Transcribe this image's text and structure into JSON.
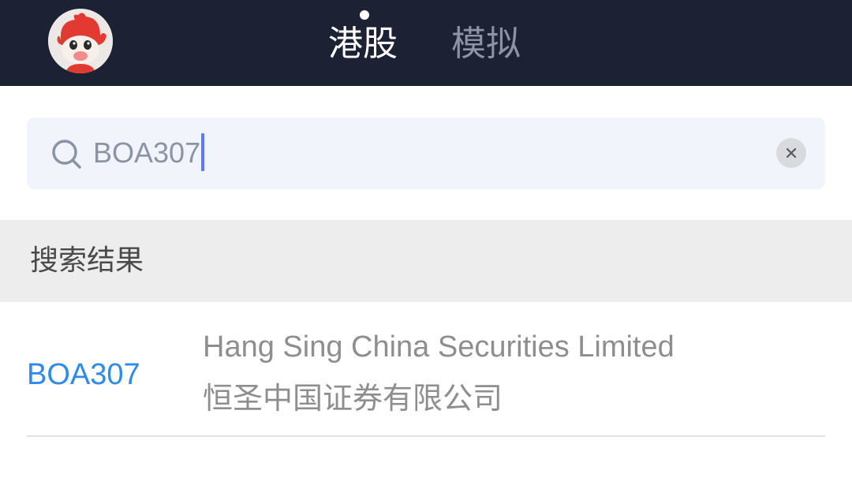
{
  "header": {
    "avatar_icon": "cartoon-mascot-avatar",
    "tabs": [
      {
        "label": "港股",
        "active": true
      },
      {
        "label": "模拟",
        "active": false
      }
    ],
    "background_color": "#1c2233",
    "active_color": "#ffffff",
    "inactive_color": "#8c93a3"
  },
  "search": {
    "icon": "search-icon",
    "value": "BOA307",
    "clear_icon": "clear-icon",
    "caret_color": "#5b7cf5"
  },
  "results": {
    "section_title": "搜索结果",
    "items": [
      {
        "code": "BOA307",
        "name_en": "Hang Sing China Securities Limited",
        "name_cn": "恒圣中国证券有限公司"
      }
    ],
    "code_color": "#2e8bea"
  }
}
